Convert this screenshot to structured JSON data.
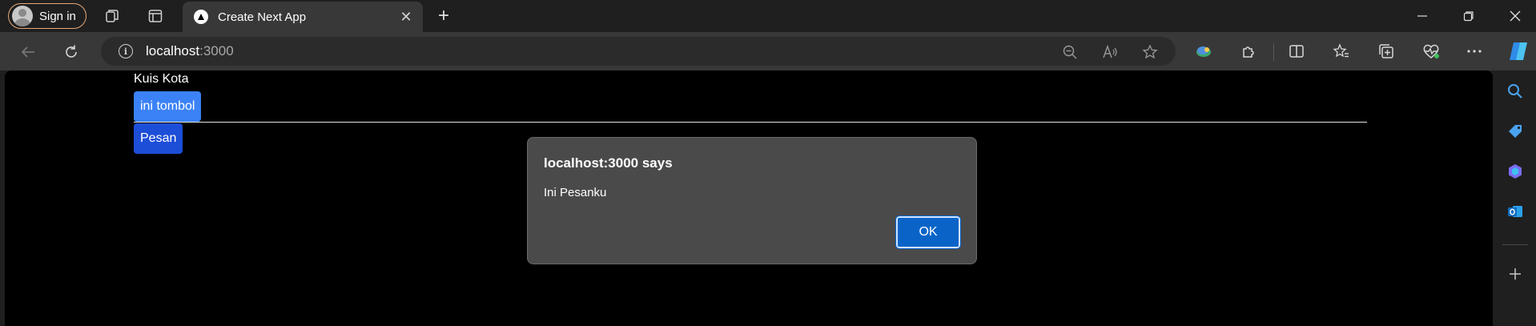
{
  "browser": {
    "signin_label": "Sign in",
    "tab_title": "Create Next App",
    "url_host": "localhost",
    "url_port": ":3000"
  },
  "page": {
    "title": "Kuis Kota",
    "button_primary": "ini tombol",
    "button_secondary": "Pesan"
  },
  "dialog": {
    "title": "localhost:3000 says",
    "message": "Ini Pesanku",
    "ok_label": "OK"
  },
  "colors": {
    "accent": "#3b82f6",
    "accent_dark": "#1d4ed8",
    "dialog_ok": "#0a64c8"
  }
}
